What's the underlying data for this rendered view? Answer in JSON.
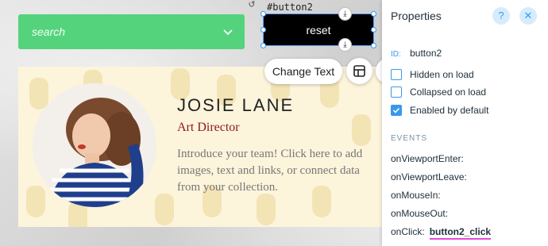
{
  "search": {
    "placeholder": "search"
  },
  "selected_element": {
    "tag": "#button2",
    "label": "reset"
  },
  "toolbar": {
    "change_text": "Change Text",
    "tools": [
      "layout-icon",
      "paint-brush-icon",
      "animation-icon",
      "link-icon",
      "help-icon",
      "database-icon"
    ]
  },
  "card": {
    "name": "JOSIE LANE",
    "role": "Art Director",
    "description": "Introduce your team! Click here to add images, text and links, or connect data from your collection."
  },
  "panel": {
    "title": "Properties",
    "help_label": "?",
    "close_label": "✕",
    "id_label": "ID:",
    "id_value": "button2",
    "hidden_label": "Hidden on load",
    "collapsed_label": "Collapsed on load",
    "enabled_label": "Enabled by default",
    "collapsed_checked": false,
    "enabled_checked": true,
    "events_header": "EVENTS",
    "events": [
      {
        "name": "onViewportEnter:"
      },
      {
        "name": "onViewportLeave:"
      },
      {
        "name": "onMouseIn:"
      },
      {
        "name": "onMouseOut:"
      },
      {
        "name": "onClick:",
        "handler": "button2_click"
      }
    ]
  },
  "colors": {
    "search_green": "#55d37c",
    "accent_blue": "#3899ec",
    "role_red": "#8b1a1a",
    "highlight_pink": "#e64ad8"
  }
}
